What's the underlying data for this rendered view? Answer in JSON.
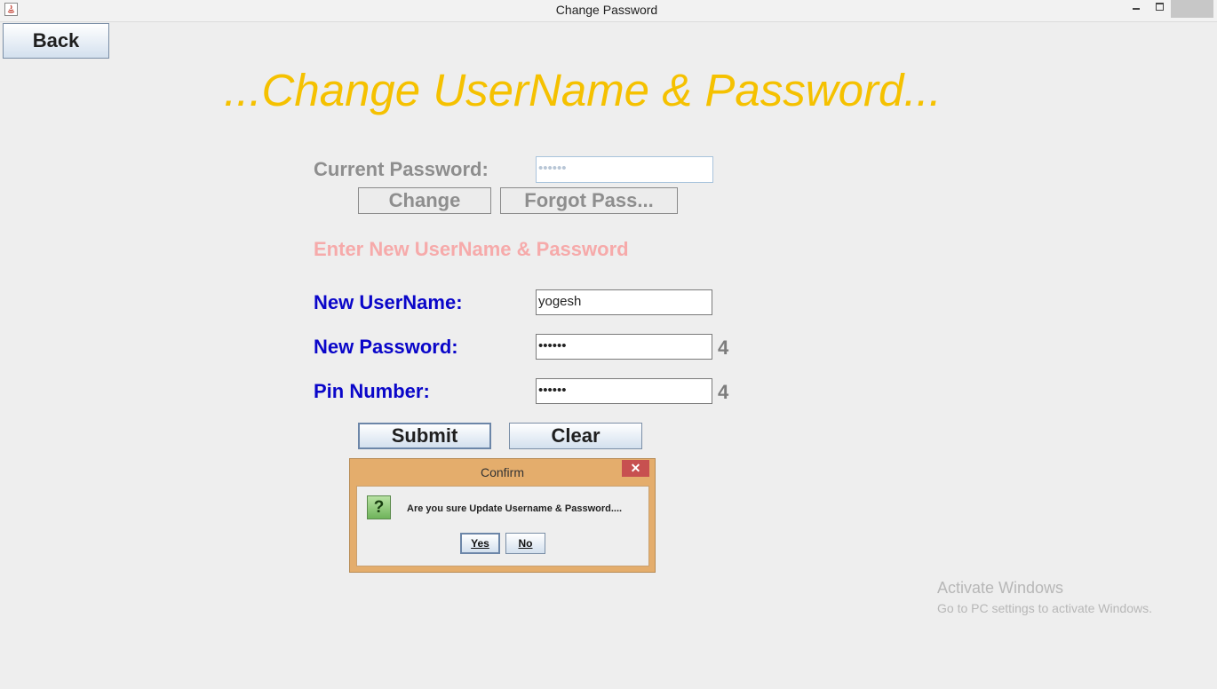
{
  "window": {
    "title": "Change Password"
  },
  "back_label": "Back",
  "heading": "...Change UserName & Password...",
  "current": {
    "label": "Current Password:",
    "value": "••••••",
    "change_label": "Change",
    "forgot_label": "Forgot Pass..."
  },
  "section_label": "Enter New UserName & Password",
  "form": {
    "username_label": "New UserName:",
    "username_value": "yogesh",
    "password_label": "New Password:",
    "password_value": "••••••",
    "password_count": "4",
    "pin_label": "Pin Number:",
    "pin_value": "••••••",
    "pin_count": "4",
    "submit_label": "Submit",
    "clear_label": "Clear"
  },
  "dialog": {
    "title": "Confirm",
    "close_glyph": "✕",
    "icon_glyph": "?",
    "message": "Are you sure Update Username & Password....",
    "yes_label": "Yes",
    "no_label": "No"
  },
  "watermark": {
    "line1": "Activate Windows",
    "line2": "Go to PC settings to activate Windows."
  },
  "colors": {
    "title_yellow": "#f5c100",
    "label_blue": "#0a06c9",
    "section_pink": "#f6aaaa",
    "dialog_frame": "#e4ad6c",
    "close_red": "#c75050"
  }
}
